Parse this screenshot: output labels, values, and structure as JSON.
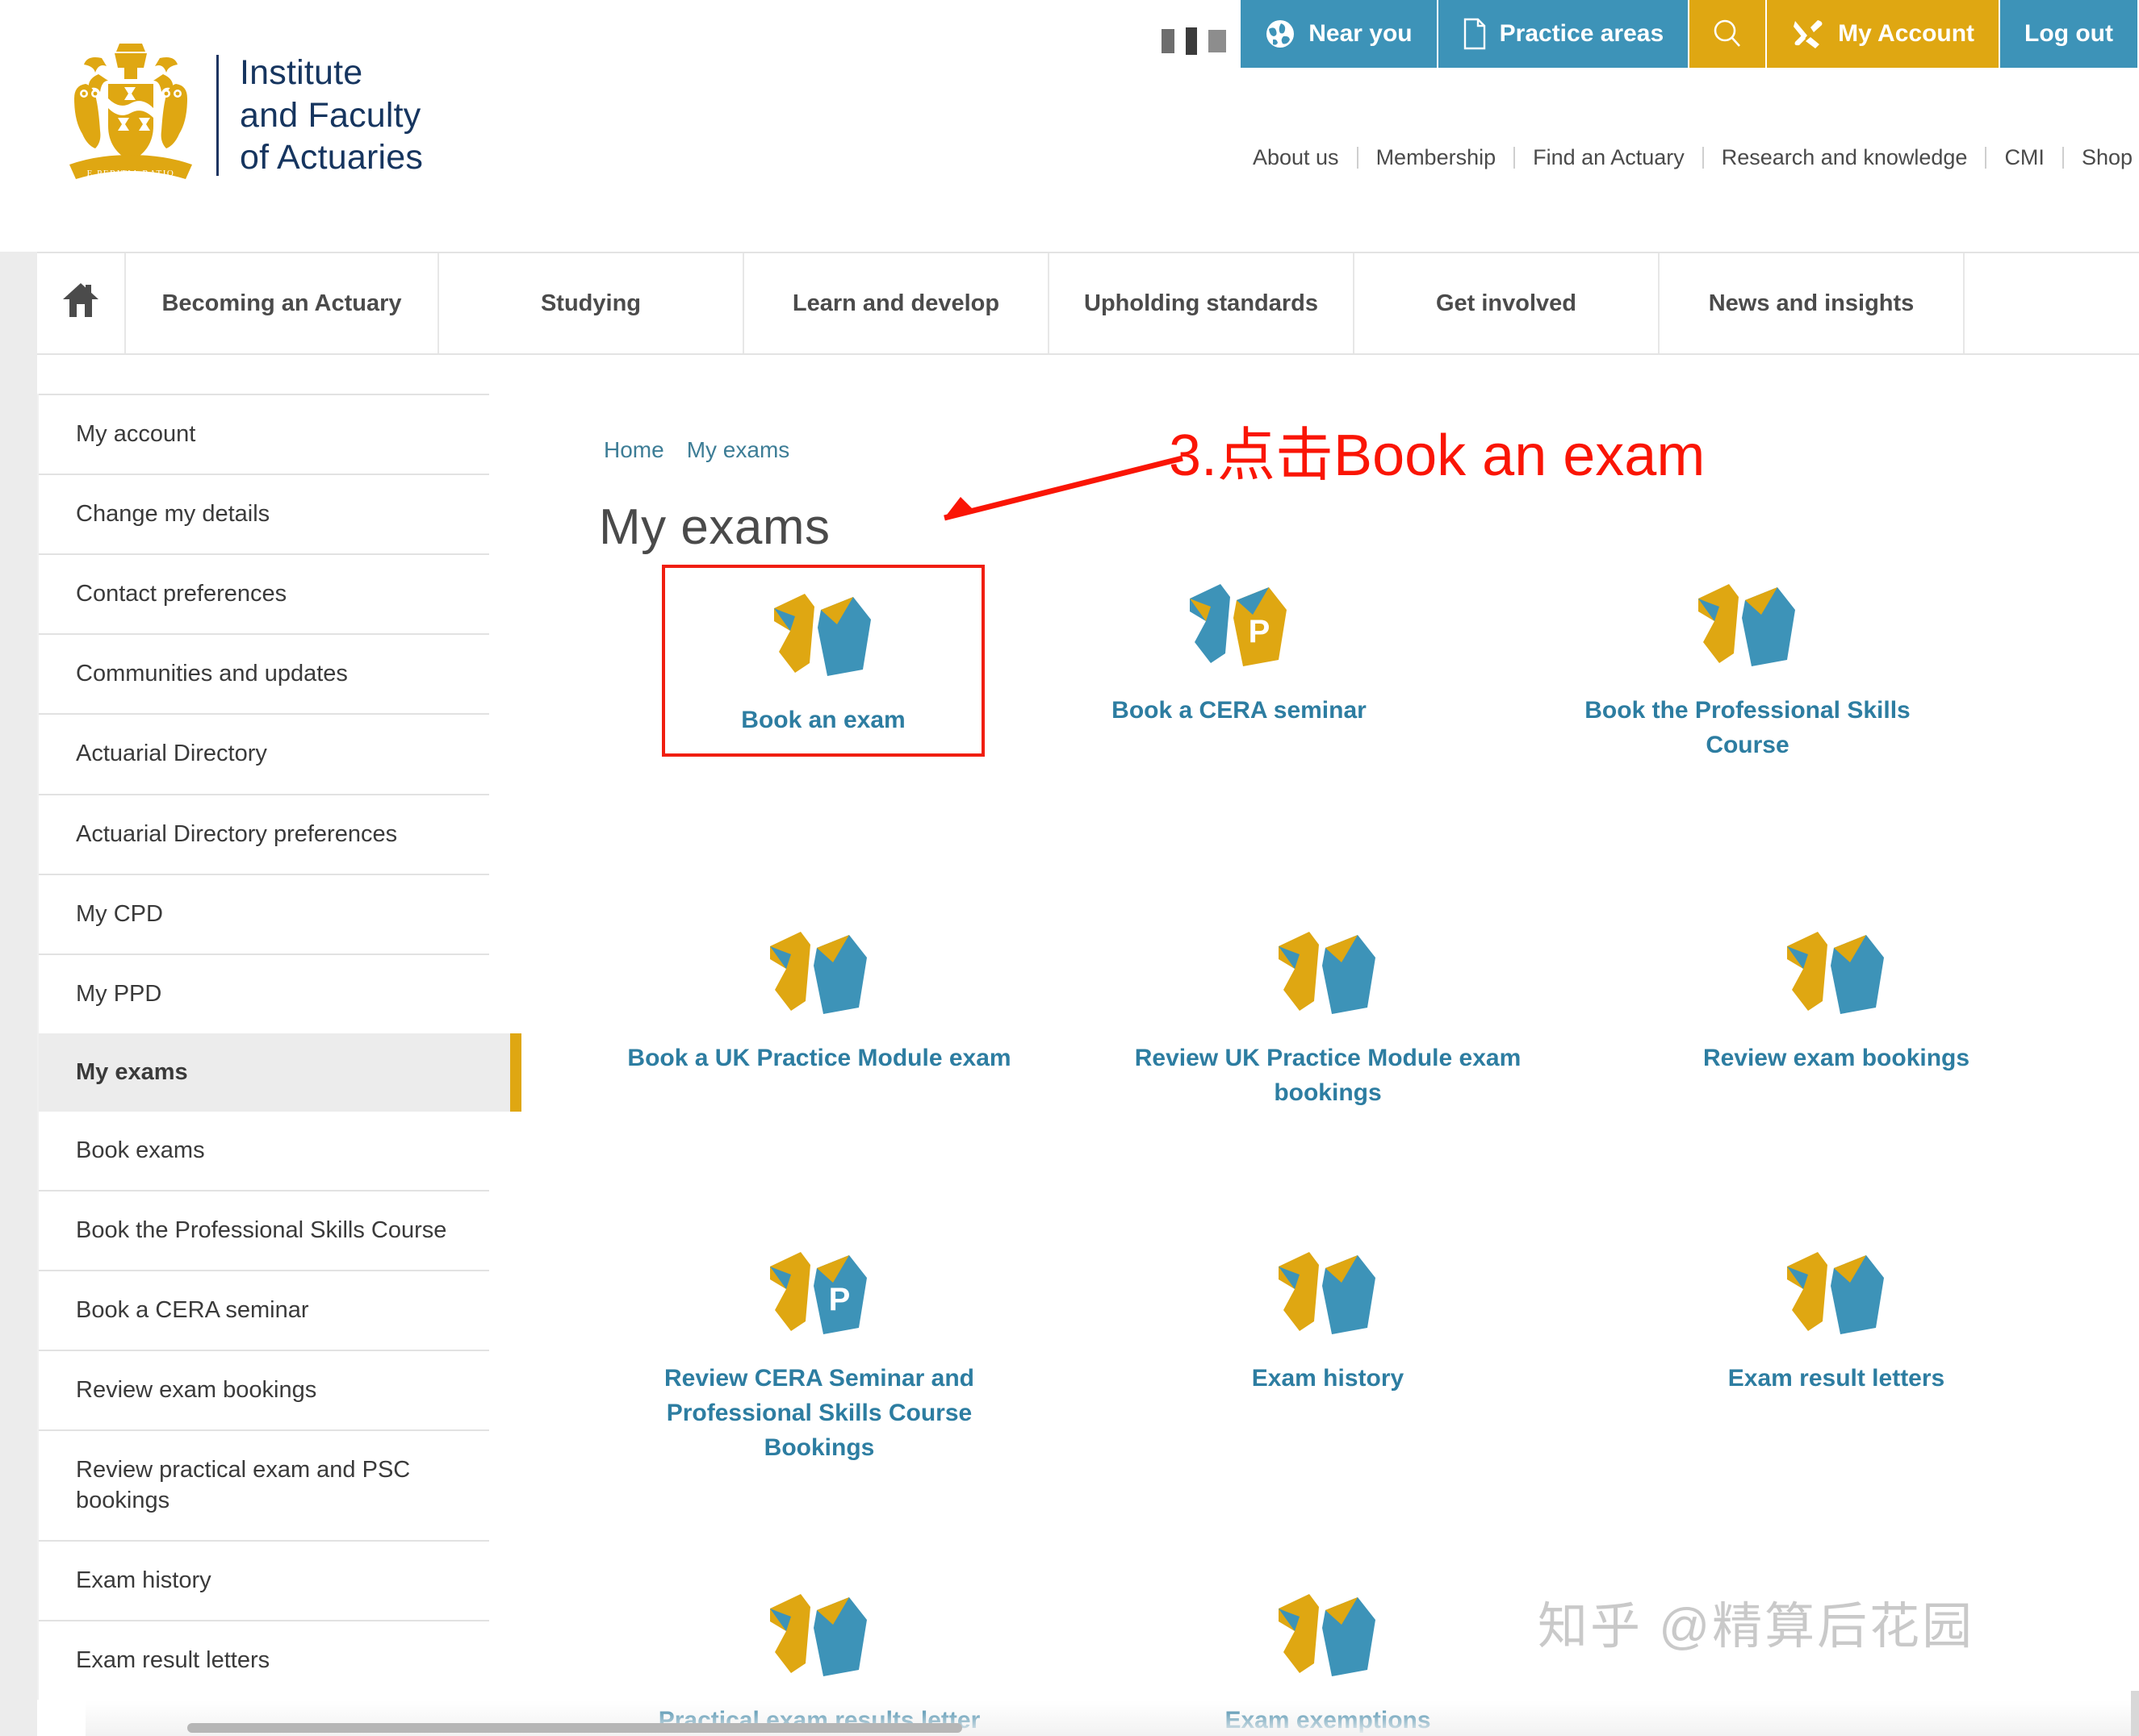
{
  "topbar": {
    "buttons": [
      {
        "label": "Near you",
        "icon": "globe-icon",
        "style": "blue"
      },
      {
        "label": "Practice areas",
        "icon": "document-icon",
        "style": "blue"
      },
      {
        "label": "",
        "icon": "search-icon",
        "style": "gold"
      },
      {
        "label": "My Account",
        "icon": "tools-icon",
        "style": "gold"
      },
      {
        "label": "Log out",
        "icon": "",
        "style": "blue"
      }
    ]
  },
  "logo": {
    "line1": "Institute",
    "line2": "and Faculty",
    "line3": "of Actuaries",
    "motto": "E PERITIA RATIO"
  },
  "utilnav": {
    "items": [
      "About us",
      "Membership",
      "Find an Actuary",
      "Research and knowledge",
      "CMI",
      "Shop"
    ]
  },
  "mainnav": {
    "home_icon": "home-icon",
    "items": [
      "Becoming an Actuary",
      "Studying",
      "Learn and develop",
      "Upholding standards",
      "Get involved",
      "News and insights"
    ]
  },
  "sidebar": {
    "items": [
      {
        "label": "My account",
        "active": false
      },
      {
        "label": "Change my details",
        "active": false
      },
      {
        "label": "Contact preferences",
        "active": false
      },
      {
        "label": "Communities and updates",
        "active": false
      },
      {
        "label": "Actuarial Directory",
        "active": false
      },
      {
        "label": "Actuarial Directory preferences",
        "active": false
      },
      {
        "label": "My CPD",
        "active": false
      },
      {
        "label": "My PPD",
        "active": false
      },
      {
        "label": "My exams",
        "active": true
      },
      {
        "label": "Book exams",
        "active": false
      },
      {
        "label": "Book the Professional Skills Course",
        "active": false
      },
      {
        "label": "Book a CERA seminar",
        "active": false
      },
      {
        "label": "Review exam bookings",
        "active": false
      },
      {
        "label": "Review practical exam and PSC bookings",
        "active": false
      },
      {
        "label": "Exam history",
        "active": false
      },
      {
        "label": "Exam result letters",
        "active": false
      }
    ]
  },
  "breadcrumb": {
    "items": [
      "Home",
      "My exams"
    ]
  },
  "page": {
    "title": "My exams"
  },
  "tiles": [
    {
      "label": "Book an exam",
      "icon": "books-gold-blue-icon",
      "highlighted": true
    },
    {
      "label": "Book a CERA seminar",
      "icon": "books-blue-gold-p-icon",
      "highlighted": false
    },
    {
      "label": "Book the Professional Skills Course",
      "icon": "books-gold-blue-icon",
      "highlighted": false
    },
    {
      "label": "Book a UK Practice Module exam",
      "icon": "books-gold-blue-icon",
      "highlighted": false
    },
    {
      "label": "Review UK Practice Module exam bookings",
      "icon": "books-gold-blue-icon",
      "highlighted": false
    },
    {
      "label": "Review exam bookings",
      "icon": "books-gold-blue-icon",
      "highlighted": false
    },
    {
      "label": "Review CERA Seminar and Professional Skills Course Bookings",
      "icon": "books-gold-blue-p-icon",
      "highlighted": false
    },
    {
      "label": "Exam history",
      "icon": "books-gold-blue-icon",
      "highlighted": false
    },
    {
      "label": "Exam result letters",
      "icon": "books-gold-blue-icon",
      "highlighted": false
    },
    {
      "label": "Practical exam results letter",
      "icon": "books-gold-blue-icon",
      "highlighted": false
    },
    {
      "label": "Exam exemptions",
      "icon": "books-gold-blue-icon",
      "highlighted": false
    }
  ],
  "annotation": {
    "text": "3.点击Book an exam",
    "color": "#fa1505"
  },
  "watermark": {
    "text": "知乎 @精算后花园"
  },
  "colors": {
    "brand_gold": "#dfa712",
    "brand_blue": "#3d93b8",
    "link_teal": "#2d7da1",
    "navy": "#16355f",
    "annotation_red": "#fa1505"
  }
}
